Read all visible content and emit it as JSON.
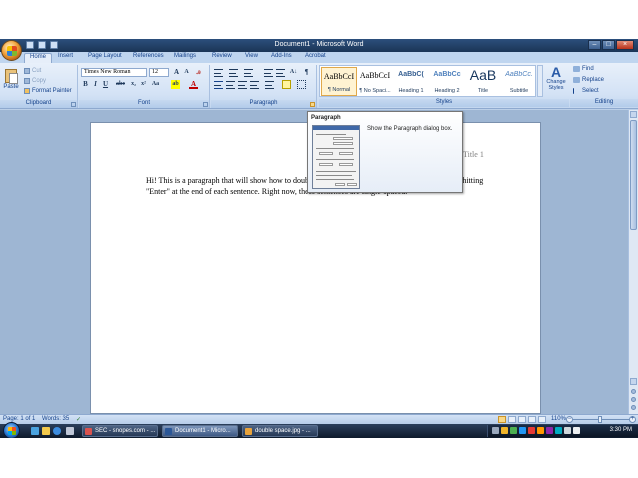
{
  "window": {
    "title": "Document1 - Microsoft Word"
  },
  "ribbon_tabs": [
    "Home",
    "Insert",
    "Page Layout",
    "References",
    "Mailings",
    "Review",
    "View",
    "Add-Ins",
    "Acrobat"
  ],
  "clipboard": {
    "paste": "Paste",
    "cut": "Cut",
    "copy": "Copy",
    "format_painter": "Format Painter",
    "label": "Clipboard"
  },
  "font": {
    "name": "Times New Roman",
    "size": "12",
    "label": "Font"
  },
  "paragraph": {
    "label": "Paragraph"
  },
  "styles": {
    "label": "Styles",
    "items": [
      {
        "sample": "AaBbCcI",
        "name": "¶ Normal"
      },
      {
        "sample": "AaBbCcI",
        "name": "¶ No Spaci..."
      },
      {
        "sample": "AaBbC(",
        "name": "Heading 1"
      },
      {
        "sample": "AaBbCc",
        "name": "Heading 2"
      },
      {
        "sample": "AaB",
        "name": "Title"
      },
      {
        "sample": "AaBbCc.",
        "name": "Subtitle"
      }
    ],
    "change_styles": "Change Styles"
  },
  "editing": {
    "label": "Editing",
    "find": "Find",
    "replace": "Replace",
    "select": "Select"
  },
  "tooltip": {
    "title": "Paragraph",
    "body": "Show the Paragraph dialog box."
  },
  "document": {
    "title_placeholder": "Title 1",
    "paragraph": "Hi! This is a paragraph that will show how to double-space automatically through Word instead of hitting \"Enter\" at the end of each sentence. Right now, these sentences are single-spaced."
  },
  "status": {
    "page": "Page: 1 of 1",
    "words": "Words: 35",
    "zoom": "110%"
  },
  "taskbar": {
    "tasks": [
      "SEC - snopes.com - ...",
      "Document1 - Micro...",
      "double space.jpg - ..."
    ],
    "clock": "3:30 PM"
  }
}
